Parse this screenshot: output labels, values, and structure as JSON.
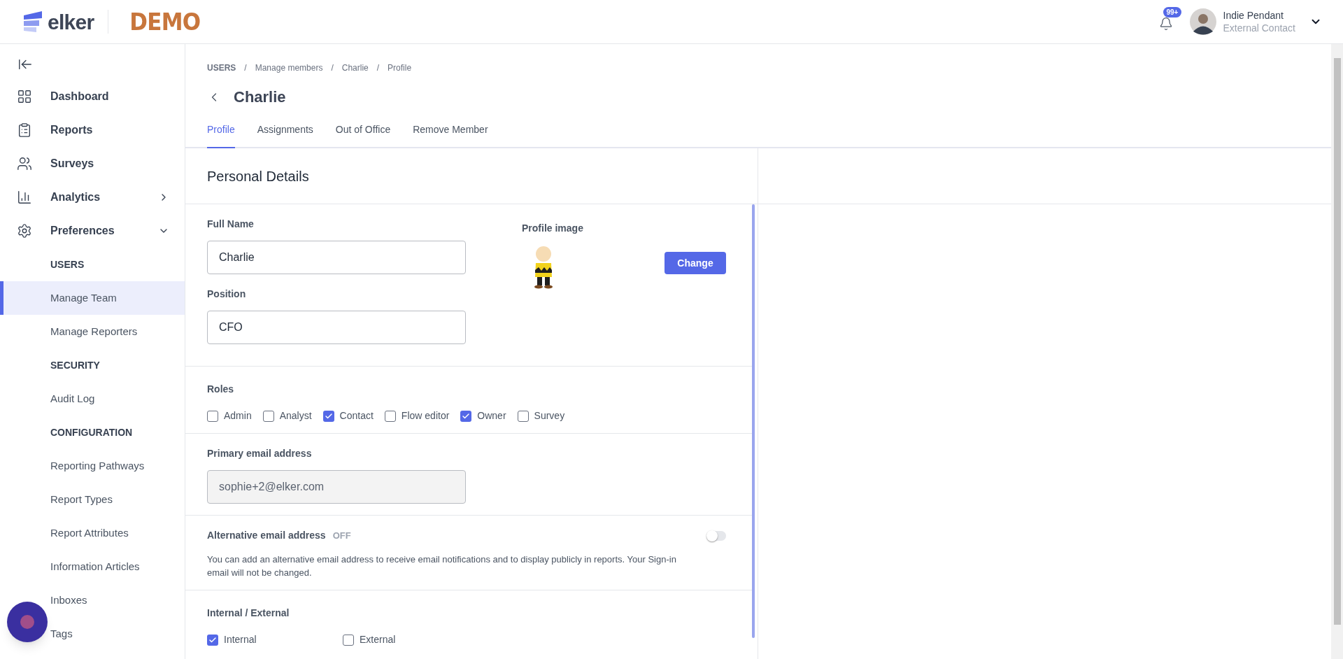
{
  "header": {
    "logo": "elker",
    "site_badge": "DEMO",
    "notifications": "99+",
    "user": {
      "name": "Indie Pendant",
      "role": "External Contact"
    }
  },
  "sidebar": {
    "items": [
      {
        "kind": "nav",
        "label": "Dashboard"
      },
      {
        "kind": "nav",
        "label": "Reports"
      },
      {
        "kind": "nav",
        "label": "Surveys"
      },
      {
        "kind": "nav",
        "label": "Analytics",
        "expanded": false
      },
      {
        "kind": "nav",
        "label": "Preferences",
        "expanded": true
      },
      {
        "kind": "heading",
        "label": "USERS"
      },
      {
        "kind": "link",
        "label": "Manage Team",
        "selected": true
      },
      {
        "kind": "link",
        "label": "Manage Reporters",
        "selected": false
      },
      {
        "kind": "heading",
        "label": "SECURITY"
      },
      {
        "kind": "link",
        "label": "Audit Log",
        "selected": false
      },
      {
        "kind": "heading",
        "label": "CONFIGURATION"
      },
      {
        "kind": "link",
        "label": "Reporting Pathways",
        "selected": false
      },
      {
        "kind": "link",
        "label": "Report Types",
        "selected": false
      },
      {
        "kind": "link",
        "label": "Report Attributes",
        "selected": false
      },
      {
        "kind": "link",
        "label": "Information Articles",
        "selected": false
      },
      {
        "kind": "link",
        "label": "Inboxes",
        "selected": false
      },
      {
        "kind": "link",
        "label": "Tags",
        "selected": false
      }
    ]
  },
  "breadcrumb": {
    "separator": "/",
    "items": [
      "USERS",
      "Manage members",
      "Charlie",
      "Profile"
    ]
  },
  "title": "Charlie",
  "tabs": [
    {
      "label": "Profile",
      "selected": true
    },
    {
      "label": "Assignments",
      "selected": false
    },
    {
      "label": "Out of Office",
      "selected": false
    },
    {
      "label": "Remove Member",
      "selected": false
    }
  ],
  "section_title": "Personal Details",
  "form": {
    "full_name": {
      "label": "Full Name",
      "value": "Charlie"
    },
    "position": {
      "label": "Position",
      "value": "CFO"
    },
    "profile_image": {
      "label": "Profile image",
      "button": "Change"
    },
    "roles": {
      "label": "Roles",
      "options": [
        {
          "label": "Admin",
          "checked": false
        },
        {
          "label": "Analyst",
          "checked": false
        },
        {
          "label": "Contact",
          "checked": true
        },
        {
          "label": "Flow editor",
          "checked": false
        },
        {
          "label": "Owner",
          "checked": true
        },
        {
          "label": "Survey",
          "checked": false
        }
      ]
    },
    "primary_email": {
      "label": "Primary email address",
      "value": "sophie+2@elker.com",
      "disabled": true
    },
    "alt_email": {
      "label": "Alternative email address",
      "state_text": "OFF",
      "on": false,
      "help": "You can add an alternative email address to receive email notifications and to display publicly in reports. Your Sign-in email will not be changed."
    },
    "internal_external": {
      "label": "Internal / External",
      "options": [
        {
          "label": "Internal",
          "checked": true
        },
        {
          "label": "External",
          "checked": false
        }
      ]
    }
  }
}
